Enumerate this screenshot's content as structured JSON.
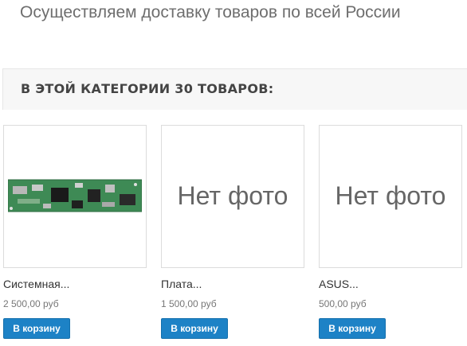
{
  "header": {
    "delivery_text": "Осуществляем доставку товаров по всей России"
  },
  "category": {
    "title": "В ЭТОЙ КАТЕГОРИИ 30 ТОВАРОВ:"
  },
  "products": [
    {
      "name": "Системная...",
      "price": "2 500,00 руб",
      "image": "motherboard-photo",
      "cart_label": "В корзину"
    },
    {
      "name": "Плата...",
      "price": "1 500,00 руб",
      "image_placeholder": "Нет фото",
      "cart_label": "В корзину"
    },
    {
      "name": "ASUS...",
      "price": "500,00 руб",
      "image_placeholder": "Нет фото",
      "cart_label": "В корзину"
    }
  ],
  "colors": {
    "button_bg": "#1d82c6",
    "header_text": "#6e6e6e",
    "category_bar_bg": "#f7f7f7"
  }
}
